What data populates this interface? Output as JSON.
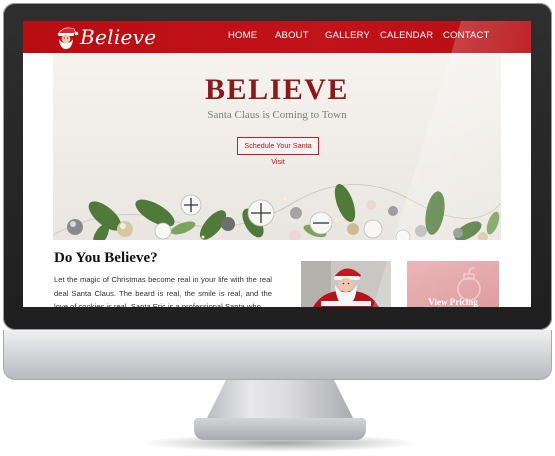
{
  "site": {
    "logo_text": "Believe",
    "nav": [
      {
        "label": "HOME"
      },
      {
        "label": "ABOUT"
      },
      {
        "label": "GALLERY"
      },
      {
        "label": "CALENDAR"
      },
      {
        "label": "CONTACT"
      }
    ]
  },
  "hero": {
    "title": "BELIEVE",
    "subtitle": "Santa Claus is Coming to Town",
    "cta_label": "Schedule Your Santa Visit"
  },
  "content": {
    "heading": "Do You Believe?",
    "body": "Let the magic of Christmas become real in your life with the real deal Santa Claus. The beard is real, the smile is real, and the love of cookies is real. Santa Eric is a professional Santa who"
  },
  "pricing": {
    "label": "View Pricing"
  },
  "colors": {
    "brand_red": "#c2121a",
    "title_red": "#8a1a1e",
    "pricing_pink": "#e3a3a6"
  },
  "icons": {
    "logo": "santa-face-icon",
    "pricing": "ornament-icon"
  }
}
